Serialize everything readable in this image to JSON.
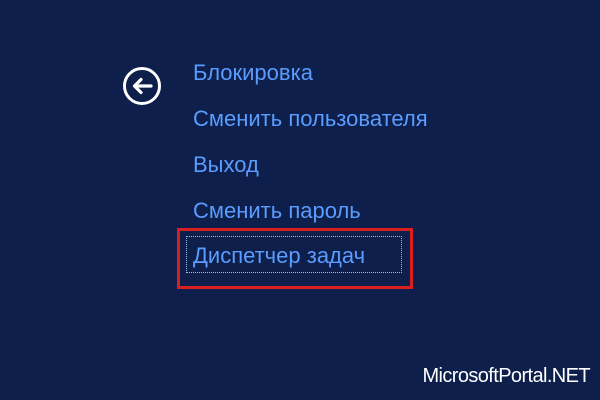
{
  "colors": {
    "background": "#0d1f4a",
    "menu_text": "#5a9cff",
    "highlight": "#d92020",
    "back_icon": "#ffffff",
    "watermark": "#ffffff"
  },
  "back_button": {
    "icon": "arrow-left-icon"
  },
  "menu": {
    "items": [
      {
        "label": "Блокировка"
      },
      {
        "label": "Сменить пользователя"
      },
      {
        "label": "Выход"
      },
      {
        "label": "Сменить пароль"
      },
      {
        "label": "Диспетчер задач",
        "focused": true,
        "highlighted": true
      }
    ]
  },
  "watermark": {
    "text": "MicrosoftPortal.NET"
  }
}
